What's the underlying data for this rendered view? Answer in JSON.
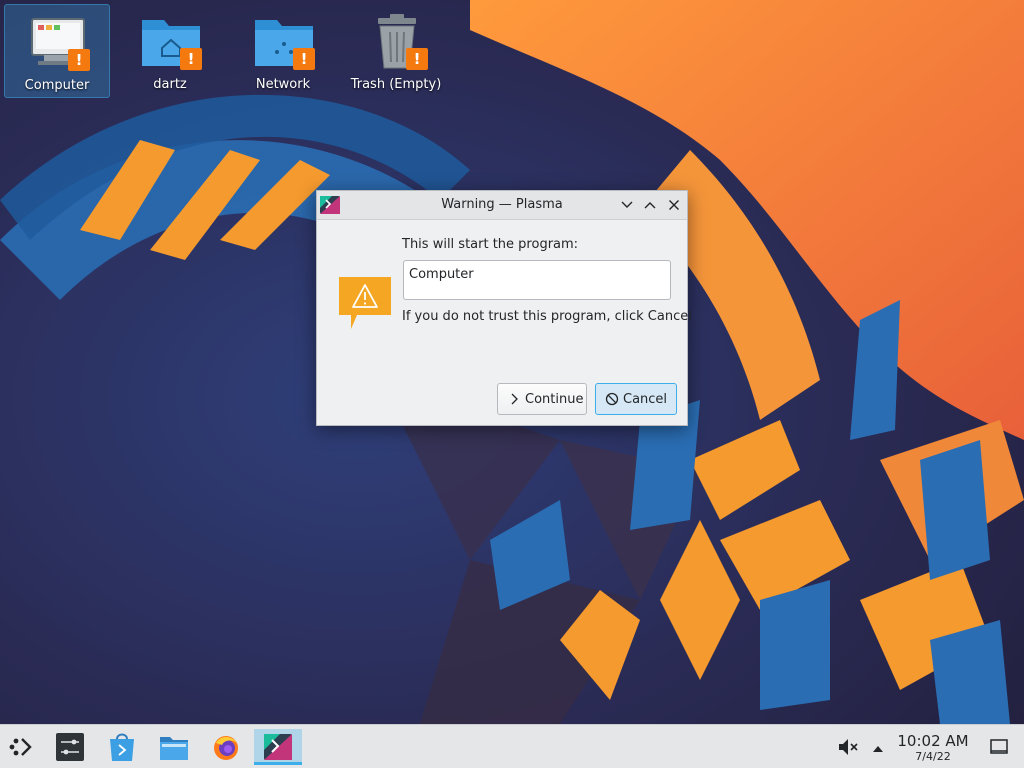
{
  "desktop": {
    "icons": [
      {
        "label": "Computer"
      },
      {
        "label": "dartz"
      },
      {
        "label": "Network"
      },
      {
        "label": "Trash (Empty)"
      }
    ],
    "badge_glyph": "!"
  },
  "dialog": {
    "title": "Warning — Plasma",
    "message_top": "This will start the program:",
    "program_name": "Computer",
    "message_bottom": "If you do not trust this program, click Cancel",
    "continue_label": "Continue",
    "cancel_label": "Cancel",
    "warning_icon": "warning-triangle-icon"
  },
  "taskbar": {
    "items": [
      "application-launcher-icon",
      "system-settings-icon",
      "discover-store-icon",
      "file-manager-icon",
      "firefox-icon",
      "plasma-window-icon"
    ],
    "clock_time": "10:02 AM",
    "clock_date": "7/4/22"
  },
  "colors": {
    "accent": "#3daee9",
    "warning": "#f5a623",
    "badge": "#f47a10",
    "folder": "#3c9ee3"
  }
}
